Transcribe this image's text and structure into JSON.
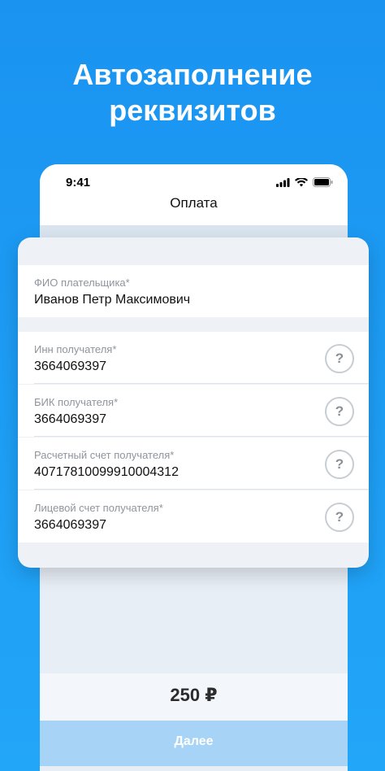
{
  "headline": {
    "line1": "Автозаполнение",
    "line2": "реквизитов"
  },
  "status_bar": {
    "time": "9:41"
  },
  "nav": {
    "title": "Оплата"
  },
  "payer": {
    "label": "ФИО плательщика*",
    "value": "Иванов Петр Максимович"
  },
  "recipient_fields": [
    {
      "label": "Инн получателя*",
      "value": "3664069397",
      "help": "?"
    },
    {
      "label": "БИК получателя*",
      "value": "3664069397",
      "help": "?"
    },
    {
      "label": "Расчетный счет получателя*",
      "value": "40717810099910004312",
      "help": "?"
    },
    {
      "label": "Лицевой счет получателя*",
      "value": "3664069397",
      "help": "?"
    }
  ],
  "amount": "250 ₽",
  "next_button": "Далее",
  "colors": {
    "background": "#1d9df5",
    "button": "#a7d4f6"
  }
}
